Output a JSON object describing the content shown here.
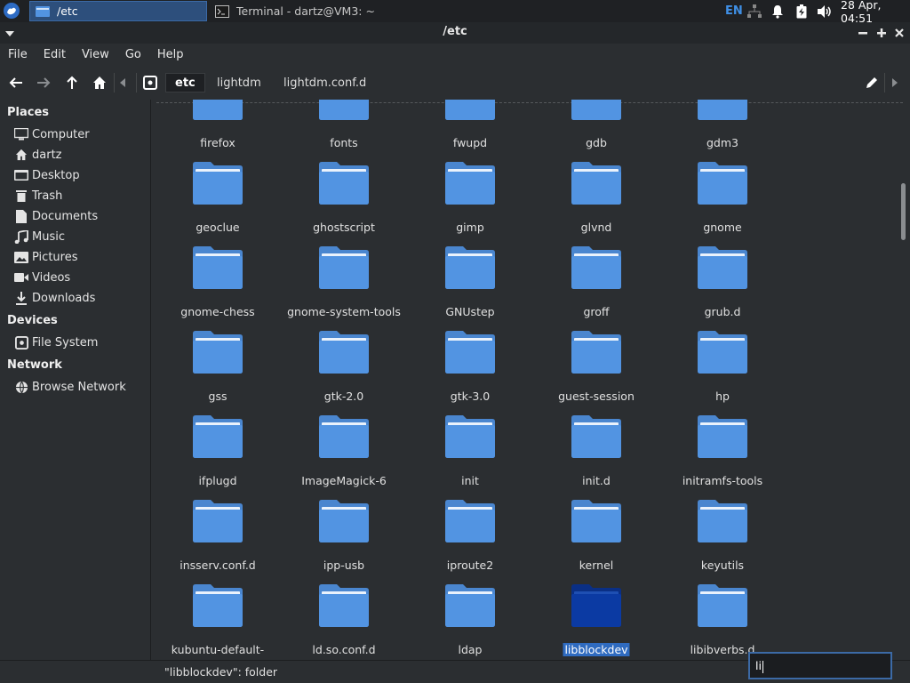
{
  "panel": {
    "tasks": [
      {
        "label": "/etc",
        "active": true
      },
      {
        "label": "Terminal - dartz@VM3: ~",
        "active": false
      }
    ],
    "lang": "EN",
    "clock": "28 Apr, 04:51"
  },
  "window": {
    "title": "/etc",
    "controls": [
      "minimize",
      "maximize",
      "close"
    ]
  },
  "menu": [
    "File",
    "Edit",
    "View",
    "Go",
    "Help"
  ],
  "toolbar": {
    "path": [
      "etc",
      "lightdm",
      "lightdm.conf.d"
    ],
    "current": "etc"
  },
  "sidebar": {
    "places_title": "Places",
    "places": [
      {
        "label": "Computer",
        "icon": "computer-icon"
      },
      {
        "label": "dartz",
        "icon": "home-icon"
      },
      {
        "label": "Desktop",
        "icon": "desktop-icon"
      },
      {
        "label": "Trash",
        "icon": "trash-icon"
      },
      {
        "label": "Documents",
        "icon": "documents-icon"
      },
      {
        "label": "Music",
        "icon": "music-icon"
      },
      {
        "label": "Pictures",
        "icon": "pictures-icon"
      },
      {
        "label": "Videos",
        "icon": "videos-icon"
      },
      {
        "label": "Downloads",
        "icon": "downloads-icon"
      }
    ],
    "devices_title": "Devices",
    "devices": [
      {
        "label": "File System",
        "icon": "drive-icon"
      }
    ],
    "network_title": "Network",
    "network": [
      {
        "label": "Browse Network",
        "icon": "network-icon"
      }
    ]
  },
  "files": [
    [
      "firefox",
      "fonts",
      "fwupd",
      "gdb",
      "gdm3"
    ],
    [
      "geoclue",
      "ghostscript",
      "gimp",
      "glvnd",
      "gnome"
    ],
    [
      "gnome-chess",
      "gnome-system-tools",
      "GNUstep",
      "groff",
      "grub.d"
    ],
    [
      "gss",
      "gtk-2.0",
      "gtk-3.0",
      "guest-session",
      "hp"
    ],
    [
      "ifplugd",
      "ImageMagick-6",
      "init",
      "init.d",
      "initramfs-tools"
    ],
    [
      "insserv.conf.d",
      "ipp-usb",
      "iproute2",
      "kernel",
      "keyutils"
    ],
    [
      "kubuntu-default-",
      "ld.so.conf.d",
      "ldap",
      "libblockdev",
      "libibverbs.d"
    ]
  ],
  "selected": "libblockdev",
  "status": "\"libblockdev\": folder",
  "typeahead": "li",
  "colors": {
    "folder": "#5294e2",
    "folder_selected": "#0b3aa3",
    "accent": "#3c6aa6"
  }
}
